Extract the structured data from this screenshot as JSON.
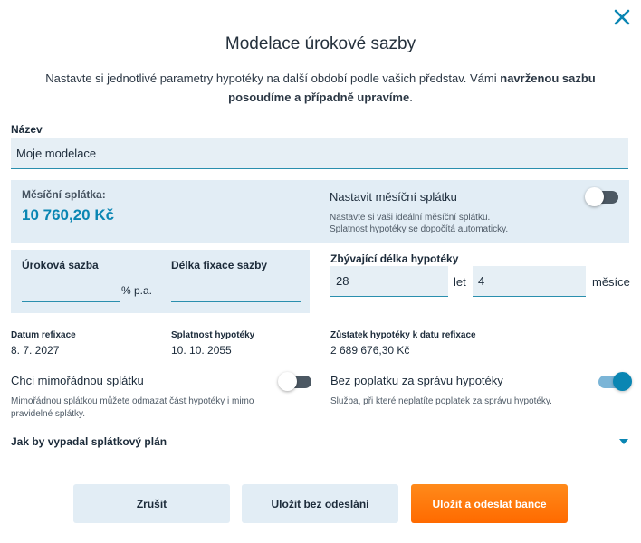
{
  "dialog": {
    "title": "Modelace úrokové sazby",
    "intro_prefix": "Nastavte si jednotlivé parametry hypotéky na další období podle vašich představ. Vámi ",
    "intro_bold": "navrženou sazbu posoudíme a případně upravíme",
    "intro_suffix": "."
  },
  "name_field": {
    "label": "Název",
    "value": "Moje modelace"
  },
  "monthly": {
    "label": "Měsíční splátka:",
    "value": "10 760,20 Kč",
    "set_label": "Nastavit měsíční splátku",
    "set_help_1": "Nastavte si vaši ideální měsíční splátku.",
    "set_help_2": "Splatnost hypotéky se dopočítá automaticky.",
    "set_toggle_on": false
  },
  "rate": {
    "label": "Úroková sazba",
    "value": "",
    "unit": "% p.a.",
    "fix_label": "Délka fixace sazby",
    "fix_value": ""
  },
  "remaining": {
    "label": "Zbývající délka hypotéky",
    "years": "28",
    "years_unit": "let",
    "months": "4",
    "months_unit": "měsíce"
  },
  "info": {
    "refix_label": "Datum refixace",
    "refix_value": "8. 7. 2027",
    "maturity_label": "Splatnost hypotéky",
    "maturity_value": "10. 10. 2055",
    "balance_label": "Zůstatek hypotéky k datu refixace",
    "balance_value": "2 689 676,30 Kč"
  },
  "options": {
    "extra_label": "Chci mimořádnou splátku",
    "extra_help_1": "Mimořádnou splátkou můžete odmazat část hypotéky i mimo",
    "extra_help_2": "pravidelné splátky.",
    "extra_on": false,
    "fee_label": "Bez poplatku za správu hypotéky",
    "fee_help": "Služba, při které neplatíte poplatek za správu hypotéky.",
    "fee_on": true
  },
  "plan": {
    "label": "Jak by vypadal splátkový plán"
  },
  "buttons": {
    "cancel": "Zrušit",
    "save_only": "Uložit bez odeslání",
    "save_send": "Uložit a odeslat bance"
  },
  "colors": {
    "accent": "#0a86b3",
    "primary": "#ff6a00",
    "panel": "#e2edf5"
  },
  "icons": {
    "close": "close-icon",
    "expand": "chevron-down-icon"
  }
}
